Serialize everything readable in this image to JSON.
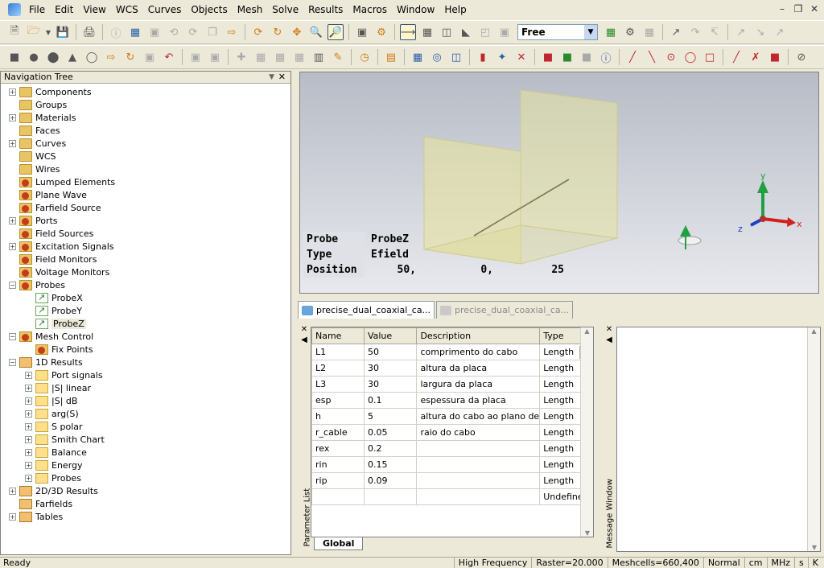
{
  "menu": [
    "File",
    "Edit",
    "View",
    "WCS",
    "Curves",
    "Objects",
    "Mesh",
    "Solve",
    "Results",
    "Macros",
    "Window",
    "Help"
  ],
  "view_mode": "Free",
  "navtree": {
    "title": "Navigation Tree",
    "items": [
      {
        "label": "Components",
        "icon": "folder",
        "expandable": true
      },
      {
        "label": "Groups",
        "icon": "folder",
        "expandable": false
      },
      {
        "label": "Materials",
        "icon": "folder",
        "expandable": true
      },
      {
        "label": "Faces",
        "icon": "folder",
        "expandable": false
      },
      {
        "label": "Curves",
        "icon": "folder",
        "expandable": true
      },
      {
        "label": "WCS",
        "icon": "folder",
        "expandable": false
      },
      {
        "label": "Wires",
        "icon": "folder",
        "expandable": false
      },
      {
        "label": "Lumped Elements",
        "icon": "red",
        "expandable": false
      },
      {
        "label": "Plane Wave",
        "icon": "red",
        "expandable": false
      },
      {
        "label": "Farfield Source",
        "icon": "red",
        "expandable": false
      },
      {
        "label": "Ports",
        "icon": "red",
        "expandable": true
      },
      {
        "label": "Field Sources",
        "icon": "red",
        "expandable": false
      },
      {
        "label": "Excitation Signals",
        "icon": "red",
        "expandable": true
      },
      {
        "label": "Field Monitors",
        "icon": "red",
        "expandable": false
      },
      {
        "label": "Voltage Monitors",
        "icon": "red",
        "expandable": false
      },
      {
        "label": "Probes",
        "icon": "red",
        "expandable": true,
        "expanded": true
      },
      {
        "label": "ProbeX",
        "icon": "probe",
        "child": true
      },
      {
        "label": "ProbeY",
        "icon": "probe",
        "child": true
      },
      {
        "label": "ProbeZ",
        "icon": "probe",
        "child": true,
        "selected": true
      },
      {
        "label": "Mesh Control",
        "icon": "red",
        "expandable": true,
        "expanded": true
      },
      {
        "label": "Fix Points",
        "icon": "red",
        "child": true
      },
      {
        "label": "1D Results",
        "icon": "result",
        "expandable": true,
        "expanded": true
      },
      {
        "label": "Port signals",
        "icon": "plainfolder",
        "child": true,
        "expandable": true
      },
      {
        "label": "|S| linear",
        "icon": "plainfolder",
        "child": true,
        "expandable": true
      },
      {
        "label": "|S| dB",
        "icon": "plainfolder",
        "child": true,
        "expandable": true
      },
      {
        "label": "arg(S)",
        "icon": "plainfolder",
        "child": true,
        "expandable": true
      },
      {
        "label": "S polar",
        "icon": "plainfolder",
        "child": true,
        "expandable": true
      },
      {
        "label": "Smith Chart",
        "icon": "plainfolder",
        "child": true,
        "expandable": true
      },
      {
        "label": "Balance",
        "icon": "plainfolder",
        "child": true,
        "expandable": true
      },
      {
        "label": "Energy",
        "icon": "plainfolder",
        "child": true,
        "expandable": true
      },
      {
        "label": "Probes",
        "icon": "plainfolder",
        "child": true,
        "expandable": true
      },
      {
        "label": "2D/3D Results",
        "icon": "result",
        "expandable": true
      },
      {
        "label": "Farfields",
        "icon": "result",
        "expandable": false
      },
      {
        "label": "Tables",
        "icon": "result",
        "expandable": true
      }
    ]
  },
  "probe_info": {
    "probe_key": "Probe",
    "probe_val": "ProbeZ",
    "type_key": "Type",
    "type_val": "Efield",
    "pos_key": "Position",
    "pos_x": "50,",
    "pos_y": "0,",
    "pos_z": "25"
  },
  "axes": {
    "x": "x",
    "y": "y",
    "z": "z"
  },
  "doc_tabs": [
    {
      "label": "precise_dual_coaxial_ca...",
      "active": true
    },
    {
      "label": "precise_dual_coaxial_ca...",
      "active": false
    }
  ],
  "params": {
    "side_label": "Parameter List",
    "columns": [
      "Name",
      "Value",
      "Description",
      "Type"
    ],
    "rows": [
      [
        "L1",
        "50",
        "comprimento do cabo",
        "Length"
      ],
      [
        "L2",
        "30",
        "altura da placa",
        "Length"
      ],
      [
        "L3",
        "30",
        "largura da placa",
        "Length"
      ],
      [
        "esp",
        "0.1",
        "espessura da placa",
        "Length"
      ],
      [
        "h",
        "5",
        "altura do cabo ao plano de",
        "Length"
      ],
      [
        "r_cable",
        "0.05",
        "raio do cabo",
        "Length"
      ],
      [
        "rex",
        "0.2",
        "",
        "Length"
      ],
      [
        "rin",
        "0.15",
        "",
        "Length"
      ],
      [
        "rip",
        "0.09",
        "",
        "Length"
      ],
      [
        "",
        "",
        "",
        "Undefined"
      ]
    ],
    "global_tab": "Global"
  },
  "message_window": {
    "side_label": "Message Window"
  },
  "status": {
    "left": "Ready",
    "panels": [
      "High Frequency",
      "Raster=20.000",
      "Meshcells=660,400",
      "Normal",
      "cm",
      "MHz",
      "s",
      "K"
    ]
  },
  "colors": {
    "accent": "#2a5ea8",
    "plate": "#e6e3a0",
    "x_axis": "#d02020",
    "y_axis": "#20a040",
    "z_axis": "#2040c0"
  }
}
